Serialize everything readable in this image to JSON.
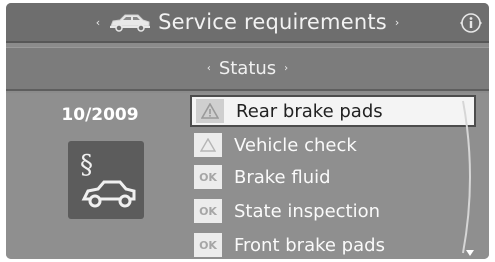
{
  "header": {
    "title": "Service requirements",
    "left_arrow": "‹",
    "right_arrow": "›",
    "info_icon": "info-icon",
    "car_icon": "car-icon"
  },
  "subheader": {
    "title": "Status",
    "left_arrow": "‹",
    "right_arrow": "›"
  },
  "left_panel": {
    "date": "10/2009",
    "icon": "legal-section-car-icon"
  },
  "list": {
    "items": [
      {
        "label": "Rear brake pads",
        "status": "warning",
        "badge": "",
        "selected": true
      },
      {
        "label": "Vehicle check",
        "status": "warning",
        "badge": "",
        "selected": false
      },
      {
        "label": "Brake fluid",
        "status": "ok",
        "badge": "OK",
        "selected": false
      },
      {
        "label": "State inspection",
        "status": "ok",
        "badge": "OK",
        "selected": false
      },
      {
        "label": "Front brake pads",
        "status": "ok",
        "badge": "OK",
        "selected": false
      }
    ],
    "scroll_down_icon": "scroll-down-icon"
  },
  "colors": {
    "background": "#8f8f8f",
    "titlebar": "#6e6e6e",
    "text": "#fafafa",
    "selected_bg": "#f4f4f4"
  }
}
